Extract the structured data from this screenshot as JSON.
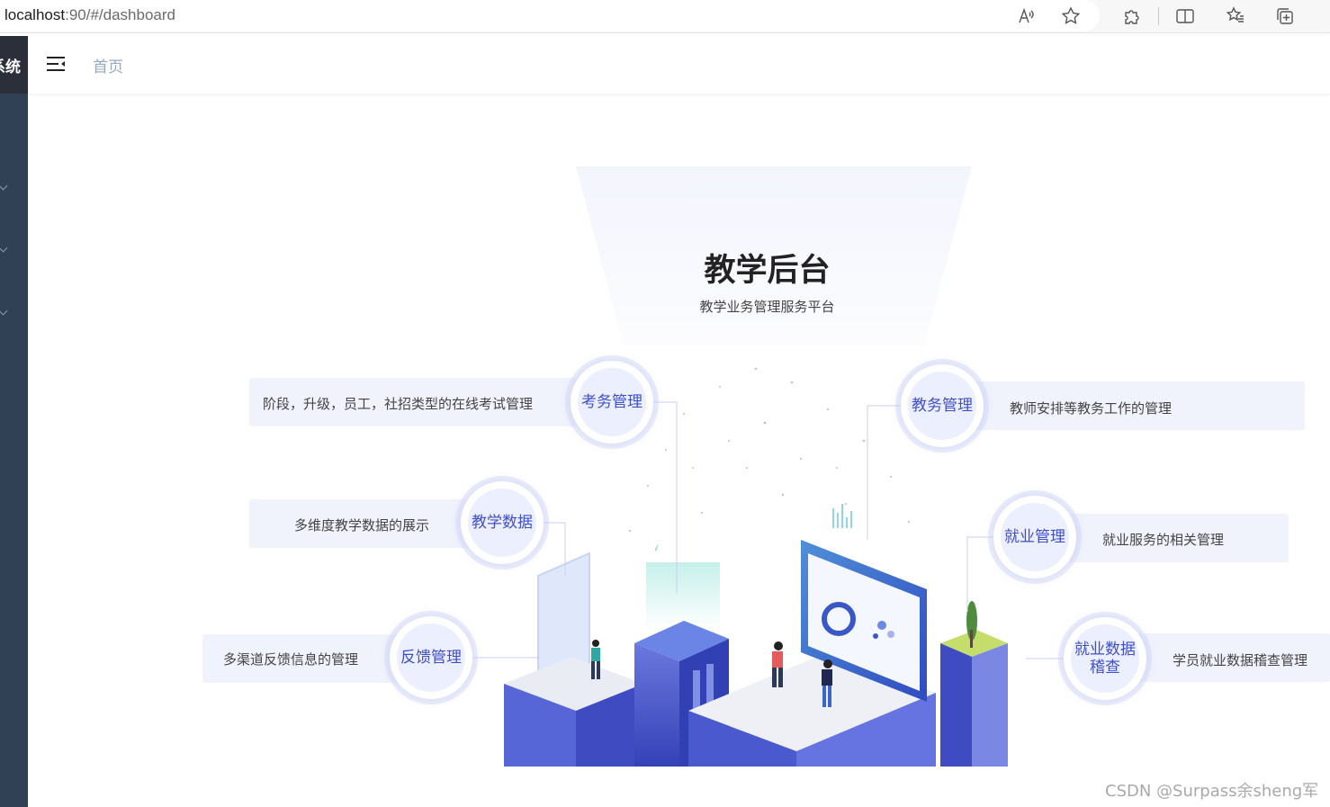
{
  "browser": {
    "url_host": "localhost",
    "url_path": ":90/#/dashboard",
    "icons": [
      "read-aloud-icon",
      "favorite-star-icon",
      "extensions-icon",
      "split-screen-icon",
      "favorites-icon",
      "collections-icon"
    ]
  },
  "sidebar": {
    "logo_text": "系统",
    "background": "#304156"
  },
  "header": {
    "menu_icon": "hamburger-fold-icon",
    "breadcrumb": "首页"
  },
  "dashboard": {
    "title": "教学后台",
    "subtitle": "教学业务管理服务平台",
    "accent": "#3f4fc8",
    "modules": {
      "exam": {
        "label": "考务管理",
        "desc": "阶段，升级，员工，社招类型的在线考试管理"
      },
      "data": {
        "label": "教学数据",
        "desc": "多维度教学数据的展示"
      },
      "feedback": {
        "label": "反馈管理",
        "desc": "多渠道反馈信息的管理"
      },
      "affairs": {
        "label": "教务管理",
        "desc": "教师安排等教务工作的管理"
      },
      "employment": {
        "label": "就业管理",
        "desc": "就业服务的相关管理"
      },
      "audit": {
        "label_line1": "就业数据",
        "label_line2": "稽查",
        "desc": "学员就业数据稽查管理"
      }
    }
  },
  "watermark": "CSDN @Surpass余sheng军"
}
